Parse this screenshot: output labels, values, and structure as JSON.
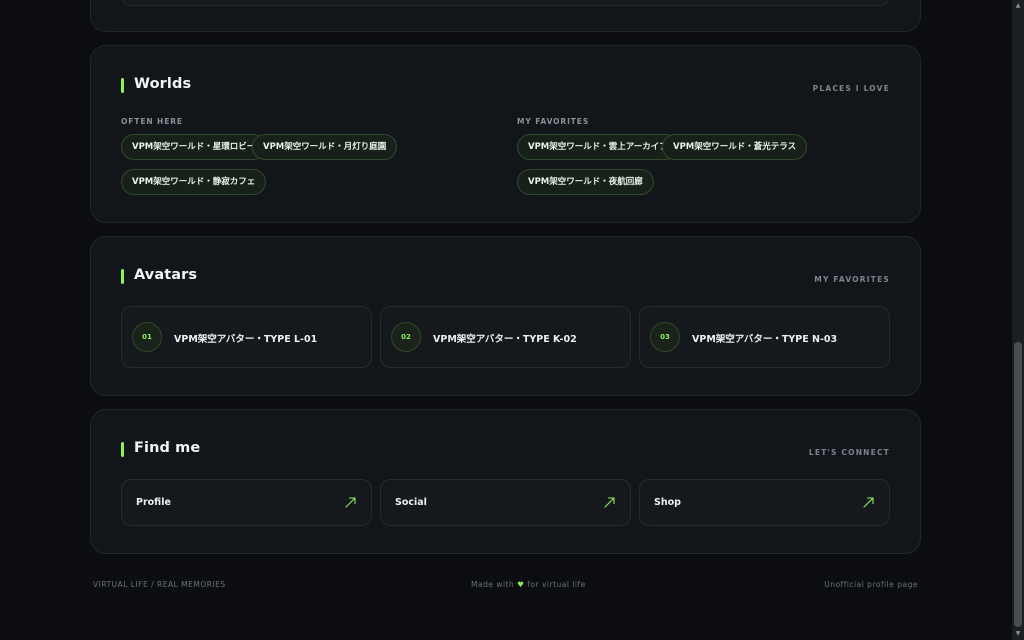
{
  "worlds": {
    "title": "Worlds",
    "subtitle": "PLACES I LOVE",
    "often": {
      "label": "OFTEN HERE",
      "chips": [
        "VPM架空ワールド・星環ロビー",
        "VPM架空ワールド・月灯り庭園",
        "VPM架空ワールド・静寂カフェ"
      ]
    },
    "favorites": {
      "label": "MY FAVORITES",
      "chips": [
        "VPM架空ワールド・雲上アーカイブ",
        "VPM架空ワールド・蒼光テラス",
        "VPM架空ワールド・夜航回廊"
      ]
    }
  },
  "avatars": {
    "title": "Avatars",
    "subtitle": "MY FAVORITES",
    "items": [
      {
        "num": "01",
        "name": "VPM架空アバター・TYPE L-01"
      },
      {
        "num": "02",
        "name": "VPM架空アバター・TYPE K-02"
      },
      {
        "num": "03",
        "name": "VPM架空アバター・TYPE N-03"
      }
    ]
  },
  "findme": {
    "title": "Find me",
    "subtitle": "LET'S CONNECT",
    "links": [
      {
        "label": "Profile",
        "icon": "arrow-up-right-icon"
      },
      {
        "label": "Social",
        "icon": "arrow-up-right-icon"
      },
      {
        "label": "Shop",
        "icon": "arrow-up-right-icon"
      }
    ]
  },
  "footer": {
    "left": "VIRTUAL LIFE / REAL MEMORIES",
    "center_prefix": "Made with",
    "heart": "♥",
    "center_suffix": "for virtual life",
    "right": "Unofficial profile page"
  },
  "colors": {
    "background": "#0b0d10",
    "card": "#121519",
    "accent": "#8ef05a"
  }
}
